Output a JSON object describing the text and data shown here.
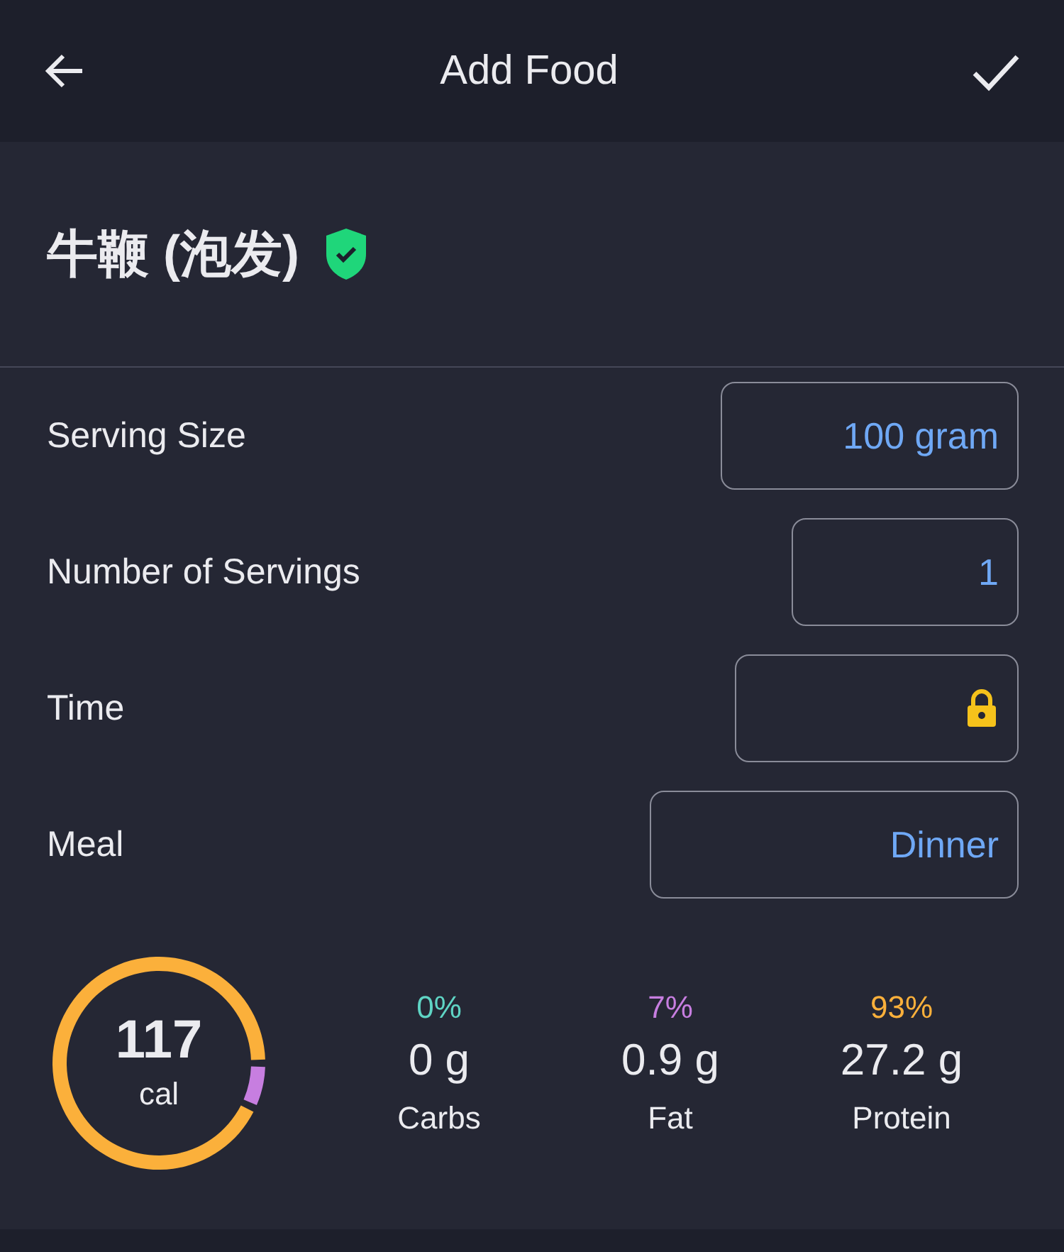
{
  "header": {
    "title": "Add Food"
  },
  "food": {
    "name": "牛鞭 (泡发)",
    "verified": true
  },
  "fields": [
    {
      "label": "Serving Size",
      "kind": "text",
      "value": "100 gram"
    },
    {
      "label": "Number of Servings",
      "kind": "text",
      "value": "1"
    },
    {
      "label": "Time",
      "kind": "locked"
    },
    {
      "label": "Meal",
      "kind": "text",
      "value": "Dinner"
    }
  ],
  "calories": {
    "value": "117",
    "unit": "cal",
    "chart_data": {
      "type": "donut",
      "values": [
        0,
        7,
        93
      ]
    }
  },
  "macros": [
    {
      "percent": "0%",
      "amount": "0 g",
      "name": "Carbs",
      "color": "#5fd4c4"
    },
    {
      "percent": "7%",
      "amount": "0.9 g",
      "name": "Fat",
      "color": "#c77ee0"
    },
    {
      "percent": "93%",
      "amount": "27.2 g",
      "name": "Protein",
      "color": "#fbb03b"
    }
  ]
}
